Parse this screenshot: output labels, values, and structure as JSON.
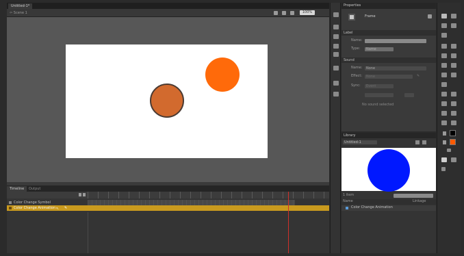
{
  "document": {
    "tab_label": "Untitled-1*",
    "breadcrumb": "Scene 1",
    "zoom": "100%"
  },
  "timeline": {
    "tabs": [
      "Timeline",
      "Output"
    ],
    "layers": [
      {
        "name": "Color Change Symbol",
        "selected": false
      },
      {
        "name": "Color Change Animation",
        "selected": true
      }
    ]
  },
  "properties": {
    "title": "Properties",
    "frame_label": "Frame",
    "label_section": "Label",
    "name_label": "Name:",
    "type_label": "Type:",
    "type_value": "Name",
    "sound_section": "Sound",
    "sound_name_label": "Name:",
    "sound_name_value": "None",
    "effect_label": "Effect:",
    "effect_value": "None",
    "sync_label": "Sync:",
    "sync_value": "Event",
    "no_sound": "No sound selected"
  },
  "library": {
    "title": "Library",
    "document": "Untitled-1",
    "items_label": "1 item",
    "name_header": "Name",
    "linkage_header": "Linkage",
    "items": [
      "Color Change Animation"
    ]
  },
  "colors": {
    "circle_brown": "#d26a2e",
    "circle_orange": "#ff6a0a",
    "library_preview": "#0018ff",
    "selected_layer": "#c99a1e",
    "stroke_swatch": "#000000",
    "fill_swatch": "#ff5a00"
  }
}
